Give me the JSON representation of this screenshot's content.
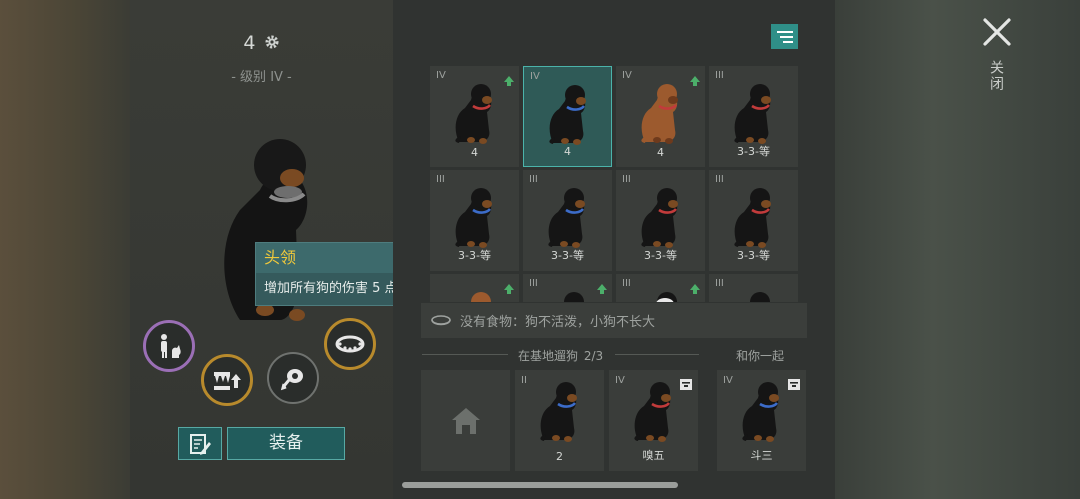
{
  "header": {
    "level_number": "4",
    "level_label": "- 级别 IV -"
  },
  "tooltip": {
    "title": "头领",
    "description": "增加所有狗的伤害 5 点"
  },
  "skills": [
    {
      "icon": "pet-command-icon",
      "ring": "purple"
    },
    {
      "icon": "fangs-upgrade-icon",
      "ring": "gold"
    },
    {
      "icon": "meat-icon",
      "ring": "grey"
    },
    {
      "icon": "collar-icon",
      "ring": "gold"
    }
  ],
  "buttons": {
    "equip_label": "装备"
  },
  "dog_grid": [
    {
      "tier": "IV",
      "name": "4",
      "upgrade": true,
      "selected": false,
      "color": "red"
    },
    {
      "tier": "IV",
      "name": "4",
      "upgrade": false,
      "selected": true,
      "color": "blue"
    },
    {
      "tier": "IV",
      "name": "4",
      "upgrade": true,
      "selected": false,
      "color": "brown"
    },
    {
      "tier": "III",
      "name": "3-3-等",
      "upgrade": false,
      "selected": false,
      "color": "red"
    },
    {
      "tier": "III",
      "name": "3-3-等",
      "upgrade": false,
      "selected": false,
      "color": "blue"
    },
    {
      "tier": "III",
      "name": "3-3-等",
      "upgrade": false,
      "selected": false,
      "color": "blue"
    },
    {
      "tier": "III",
      "name": "3-3-等",
      "upgrade": false,
      "selected": false,
      "color": "red"
    },
    {
      "tier": "III",
      "name": "3-3-等",
      "upgrade": false,
      "selected": false,
      "color": "red"
    },
    {
      "tier": "",
      "name": "",
      "upgrade": true,
      "selected": false,
      "color": "brown"
    },
    {
      "tier": "III",
      "name": "",
      "upgrade": true,
      "selected": false,
      "color": "blue"
    },
    {
      "tier": "III",
      "name": "",
      "upgrade": true,
      "selected": false,
      "color": "white"
    },
    {
      "tier": "III",
      "name": "",
      "upgrade": false,
      "selected": false,
      "color": "red"
    }
  ],
  "food_status": "没有食物：狗不活泼，小狗不长大",
  "base_section": {
    "label": "在基地遛狗",
    "count": "2/3"
  },
  "with_you_section": {
    "label": "和你一起"
  },
  "base_dogs": [
    {
      "tier": "",
      "name": "",
      "kind": "home"
    },
    {
      "tier": "II",
      "name": "2",
      "kind": "dog",
      "color": "blue",
      "badge": false
    },
    {
      "tier": "IV",
      "name": "嗅五",
      "kind": "dog",
      "color": "red",
      "badge": true
    }
  ],
  "with_you_dogs": [
    {
      "tier": "IV",
      "name": "斗三",
      "kind": "dog",
      "color": "blue",
      "badge": true
    }
  ],
  "close_label": "关闭",
  "colors": {
    "accent": "#2f8f88",
    "upgrade": "#4caf6a",
    "tooltip_title": "#f1c93b"
  }
}
